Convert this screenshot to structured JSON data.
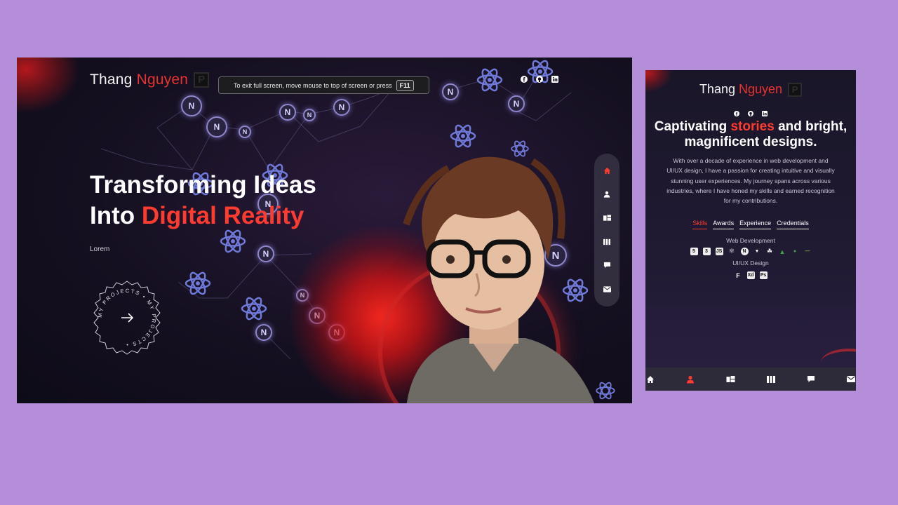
{
  "desktop": {
    "brand": {
      "first": "Thang",
      "last": "Nguyen",
      "logo_letter": "P"
    },
    "fullscreen_tip": {
      "text": "To exit full screen, move mouse to top of screen or press",
      "key": "F11"
    },
    "social_icons": [
      "facebook-icon",
      "github-icon",
      "linkedin-icon"
    ],
    "hero": {
      "line1": "Transforming Ideas",
      "line2_white": "Into",
      "line2_red": "Digital Reality",
      "subtitle": "Lorem"
    },
    "cta_badge": {
      "ring_text": "MY PROJECTS • MY PROJECTS •",
      "icon": "arrow-right-icon"
    },
    "side_nav": [
      "home-icon",
      "user-icon",
      "projects-icon",
      "columns-icon",
      "chat-icon",
      "mail-icon"
    ],
    "colors": {
      "accent": "#ff3b30",
      "background": "#151021",
      "page_bg": "#b48ed8"
    }
  },
  "mobile": {
    "brand": {
      "first": "Thang",
      "last": "Nguyen",
      "logo_letter": "P"
    },
    "social_icons": [
      "facebook-icon",
      "github-icon",
      "linkedin-icon"
    ],
    "headline": {
      "pre": "Captivating",
      "red": "stories",
      "post": "and bright,",
      "line2": "magnificent designs."
    },
    "paragraph": "With over a decade of experience in web development and UI/UX design, I have a passion for creating intuitive and visually stunning user experiences. My journey spans across various industries, where I have honed my skills and earned recognition for my contributions.",
    "tabs": [
      {
        "label": "Skills",
        "active": true
      },
      {
        "label": "Awards",
        "active": false
      },
      {
        "label": "Experience",
        "active": false
      },
      {
        "label": "Credentials",
        "active": false
      }
    ],
    "categories": {
      "web": {
        "title": "Web Development",
        "icons": [
          "html5-icon",
          "css3-icon",
          "javascript-icon",
          "react-icon",
          "nextjs-icon",
          "framer-icon",
          "redux-icon",
          "mongodb-icon",
          "nodejs-icon",
          "gsap-icon"
        ]
      },
      "uiux": {
        "title": "UI/UX Design",
        "icons": [
          "figma-icon",
          "xd-icon",
          "photoshop-icon"
        ]
      }
    },
    "bottom_nav": [
      "home-icon",
      "user-icon",
      "projects-icon",
      "columns-icon",
      "chat-icon",
      "mail-icon"
    ]
  }
}
